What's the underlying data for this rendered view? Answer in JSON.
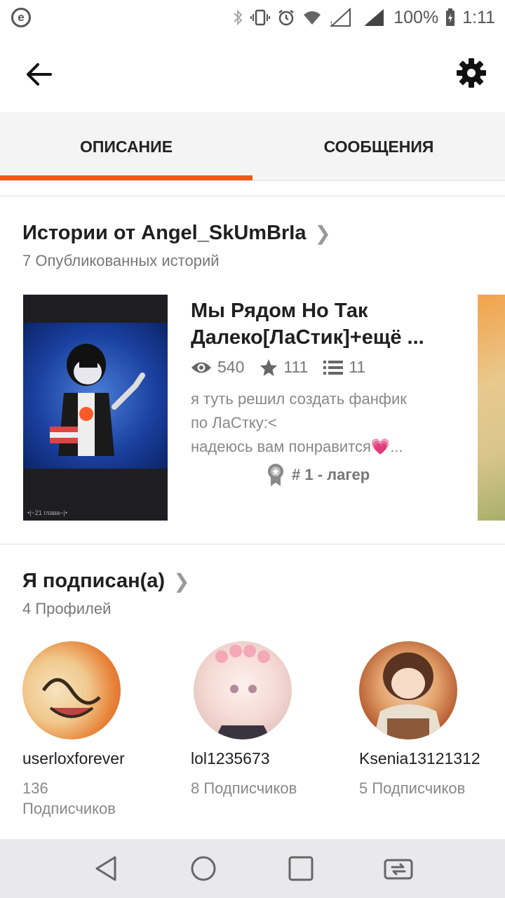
{
  "status_bar": {
    "battery": "100%",
    "time": "1:11",
    "icons": [
      "e-app-icon",
      "bluetooth-icon",
      "vibrate-icon",
      "alarm-icon",
      "wifi-icon",
      "signal-icon",
      "battery-icon"
    ]
  },
  "header": {
    "back_icon": "back-arrow-icon",
    "settings_icon": "gear-icon"
  },
  "tabs": [
    {
      "label": "ОПИСАНИЕ",
      "active": true
    },
    {
      "label": "СООБЩЕНИЯ",
      "active": false
    }
  ],
  "colors": {
    "accent": "#ee5a14"
  },
  "stories_section": {
    "title": "Истории от Angel_SkUmBrIa",
    "subtitle": "7 Опубликованных историй",
    "story": {
      "title": "Мы Рядом Но Так Далеко[ЛаСтик]+ещё ...",
      "cover_caption": "•|~21 глава~|•",
      "views": "540",
      "stars": "111",
      "chapters": "11",
      "description_line1": "я туть решил создать фанфик",
      "description_line2": "по ЛаСтку:<",
      "description_line3": "надеюсь вам понравится💗...",
      "rank": "# 1 - лагер"
    }
  },
  "following_section": {
    "title": "Я подписан(а)",
    "subtitle": "4 Профилей",
    "profiles": [
      {
        "name": "userloxforever",
        "followers": "136 Подписчиков"
      },
      {
        "name": "lol1235673",
        "followers": "8 Подписчиков"
      },
      {
        "name": "Ksenia13121312",
        "followers": "5 Подписчиков"
      }
    ]
  },
  "nav_bar": {
    "buttons": [
      "back-triangle-icon",
      "home-circle-icon",
      "recents-square-icon",
      "switch-sim-icon"
    ]
  }
}
